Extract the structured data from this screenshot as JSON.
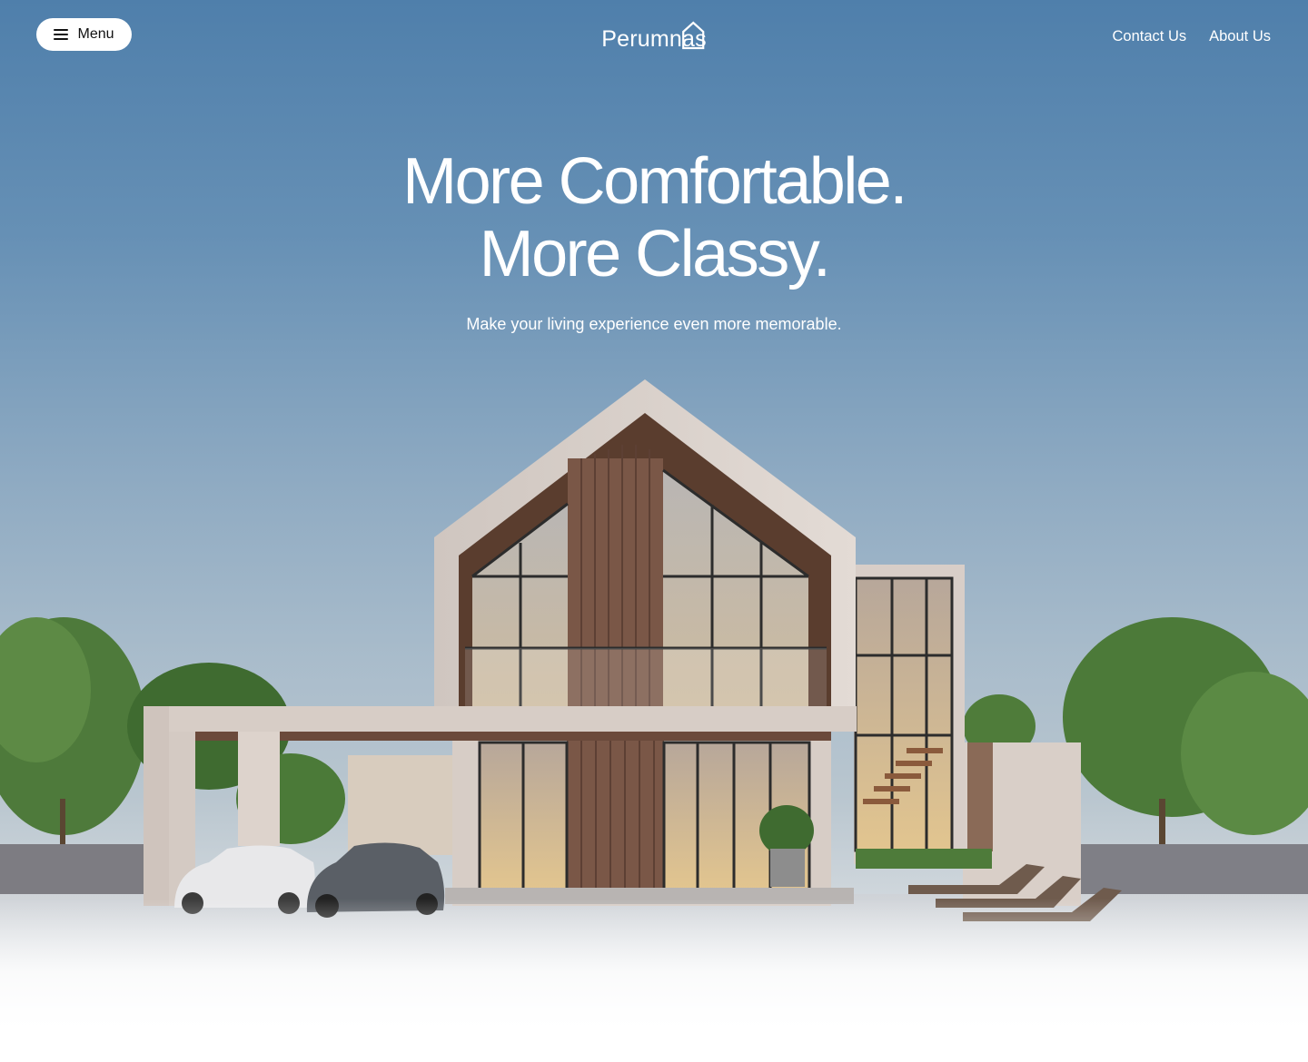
{
  "header": {
    "menu_label": "Menu",
    "logo_text": "Perumnas",
    "nav": [
      {
        "label": "Contact Us"
      },
      {
        "label": "About Us"
      }
    ]
  },
  "hero": {
    "headline_line1": "More Comfortable.",
    "headline_line2": "More Classy.",
    "subheadline": "Make your living experience even more memorable."
  },
  "colors": {
    "sky_top": "#4f7fab",
    "text": "#ffffff",
    "menu_bg": "#ffffff"
  },
  "icons": [
    "hamburger-icon",
    "house-logo-icon"
  ]
}
